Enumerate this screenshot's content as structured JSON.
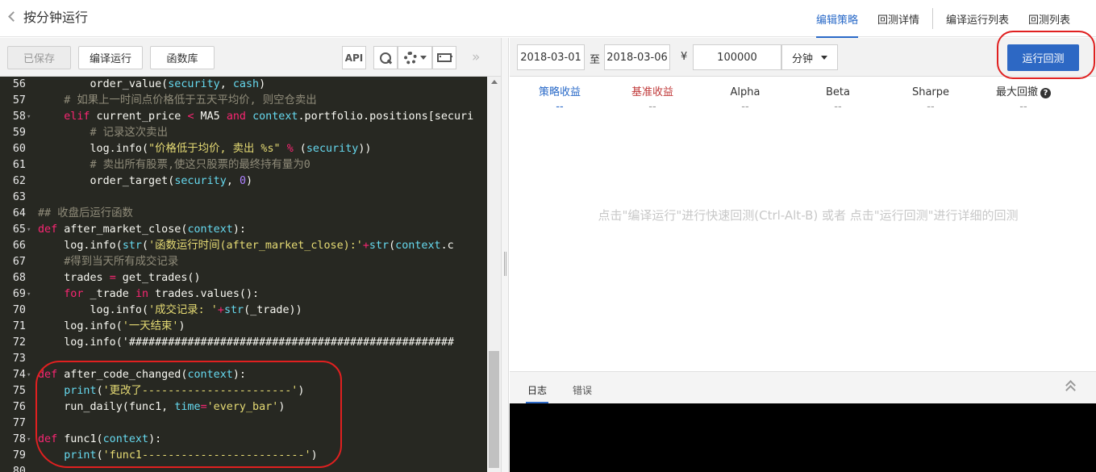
{
  "header": {
    "title": "按分钟运行",
    "tabs": [
      {
        "label": "编辑策略"
      },
      {
        "label": "回测详情"
      },
      {
        "label": "编译运行列表"
      },
      {
        "label": "回测列表"
      }
    ]
  },
  "left_toolbar": {
    "saved_label": "已保存",
    "compile_label": "编译运行",
    "funclib_label": "函数库",
    "api_label": "API",
    "collapse_label": "»"
  },
  "editor": {
    "language": "python",
    "lines": [
      {
        "n": "56",
        "fold": "",
        "text": "        order_value(security, cash)"
      },
      {
        "n": "57",
        "fold": "",
        "text": "    # 如果上一时间点价格低于五天平均价, 则空仓卖出"
      },
      {
        "n": "58",
        "fold": "▾",
        "text": "    elif current_price < MA5 and context.portfolio.positions[securi"
      },
      {
        "n": "59",
        "fold": "",
        "text": "        # 记录这次卖出"
      },
      {
        "n": "60",
        "fold": "",
        "text": "        log.info(\"价格低于均价, 卖出 %s\" % (security))"
      },
      {
        "n": "61",
        "fold": "",
        "text": "        # 卖出所有股票,使这只股票的最终持有量为0"
      },
      {
        "n": "62",
        "fold": "",
        "text": "        order_target(security, 0)"
      },
      {
        "n": "63",
        "fold": "",
        "text": ""
      },
      {
        "n": "64",
        "fold": "",
        "text": "## 收盘后运行函数"
      },
      {
        "n": "65",
        "fold": "▾",
        "text": "def after_market_close(context):"
      },
      {
        "n": "66",
        "fold": "",
        "text": "    log.info(str('函数运行时间(after_market_close):'+str(context.c"
      },
      {
        "n": "67",
        "fold": "",
        "text": "    #得到当天所有成交记录"
      },
      {
        "n": "68",
        "fold": "",
        "text": "    trades = get_trades()"
      },
      {
        "n": "69",
        "fold": "▾",
        "text": "    for _trade in trades.values():"
      },
      {
        "n": "70",
        "fold": "",
        "text": "        log.info('成交记录: '+str(_trade))"
      },
      {
        "n": "71",
        "fold": "",
        "text": "    log.info('一天结束')"
      },
      {
        "n": "72",
        "fold": "",
        "text": "    log.info('##################################################"
      },
      {
        "n": "73",
        "fold": "",
        "text": ""
      },
      {
        "n": "74",
        "fold": "▾",
        "text": "def after_code_changed(context):"
      },
      {
        "n": "75",
        "fold": "",
        "text": "    print('更改了-----------------------')"
      },
      {
        "n": "76",
        "fold": "",
        "text": "    run_daily(func1, time='every_bar')"
      },
      {
        "n": "77",
        "fold": "",
        "text": ""
      },
      {
        "n": "78",
        "fold": "▾",
        "text": "def func1(context):"
      },
      {
        "n": "79",
        "fold": "",
        "text": "    print('func1-------------------------')"
      },
      {
        "n": "80",
        "fold": "",
        "text": ""
      }
    ]
  },
  "right_toolbar": {
    "start_date": "2018-03-01",
    "to_label": "至",
    "end_date": "2018-03-06",
    "currency_symbol": "¥",
    "capital": "100000",
    "frequency": "分钟",
    "run_backtest_label": "运行回测"
  },
  "metrics": [
    {
      "label": "策略收益",
      "value": "--"
    },
    {
      "label": "基准收益",
      "value": "--"
    },
    {
      "label": "Alpha",
      "value": "--"
    },
    {
      "label": "Beta",
      "value": "--"
    },
    {
      "label": "Sharpe",
      "value": "--"
    },
    {
      "label": "最大回撤",
      "value": "--"
    }
  ],
  "hint": "点击\"编译运行\"进行快速回测(Ctrl-Alt-B) 或者 点击\"运行回测\"进行详细的回测",
  "log_panel": {
    "tabs": [
      {
        "label": "日志"
      },
      {
        "label": "错误"
      }
    ]
  },
  "colors": {
    "accent": "#2d68c4",
    "editor_bg": "#272822",
    "annotation": "#e02020"
  }
}
